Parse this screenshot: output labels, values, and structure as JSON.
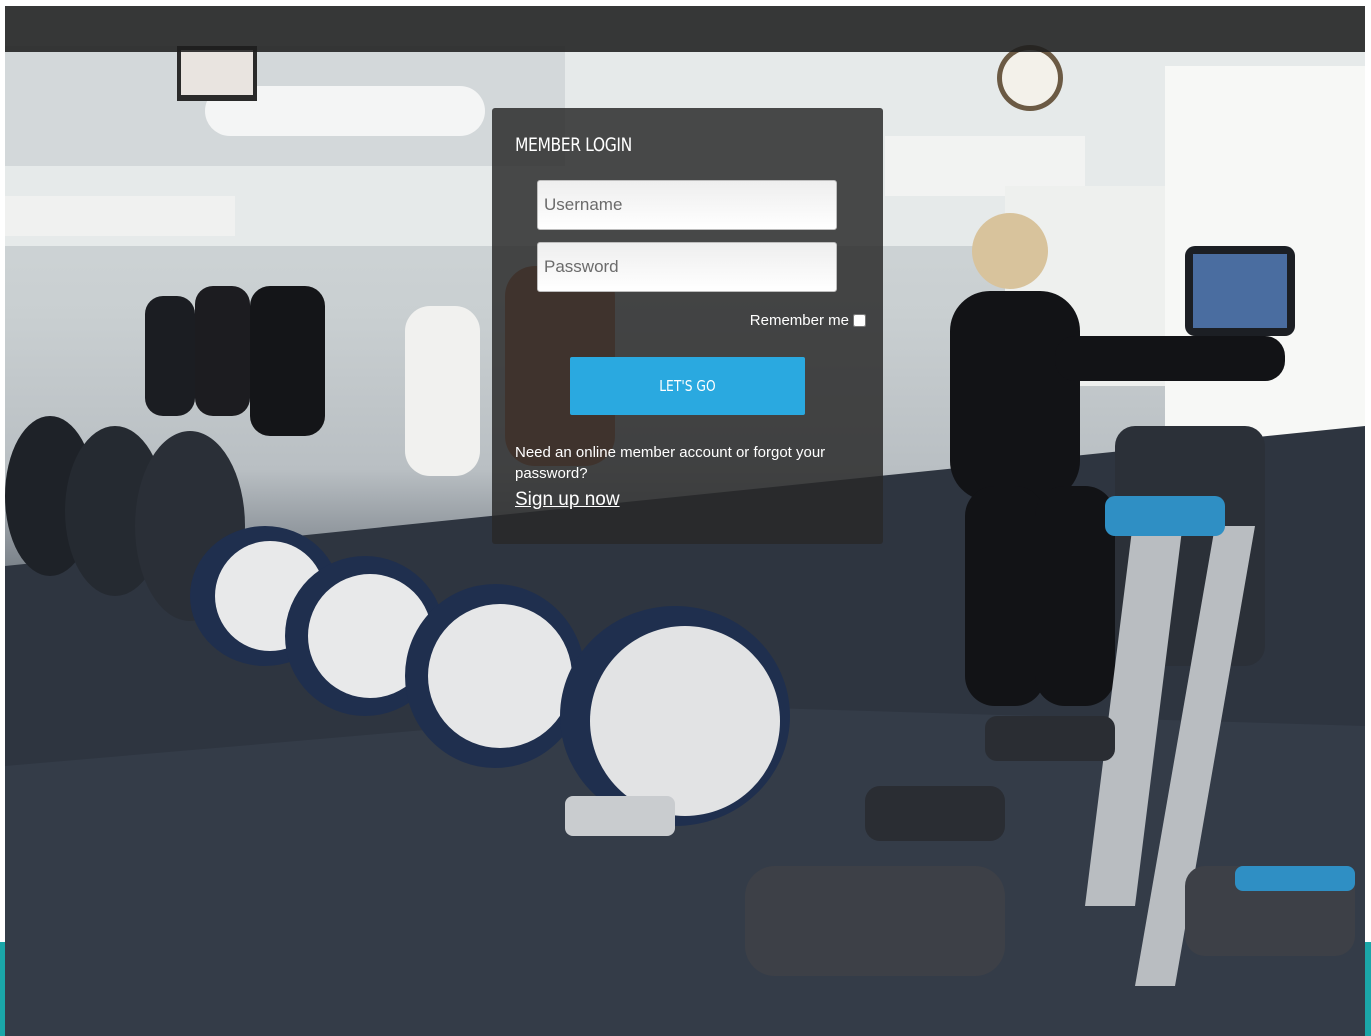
{
  "login": {
    "title": "MEMBER LOGIN",
    "username_placeholder": "Username",
    "password_placeholder": "Password",
    "remember_label": "Remember me",
    "submit_label": "LET'S GO",
    "help_text": "Need an online member account or forgot your password?",
    "signup_label": "Sign up now"
  },
  "colors": {
    "button": "#2aa9e0",
    "panel": "rgba(40,40,40,0.84)",
    "accent_edge": "#1aa6a8"
  },
  "background": {
    "icon": "gym-elliptical-photo"
  }
}
